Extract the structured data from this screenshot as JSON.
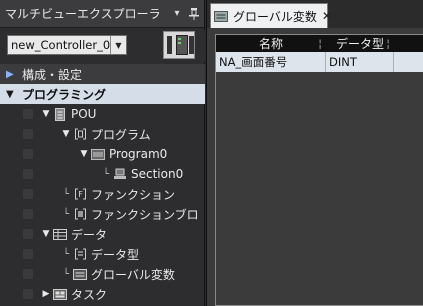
{
  "left_panel": {
    "title": "マルチビューエクスプローラ",
    "controller": {
      "value": "new_Controller_0"
    },
    "sections": {
      "config": "構成・設定",
      "programming": "プログラミング"
    },
    "tree": {
      "pou": "POU",
      "program": "プログラム",
      "program0": "Program0",
      "section0": "Section0",
      "function": "ファンクション",
      "function_block": "ファンクションブロ",
      "data": "データ",
      "data_type": "データ型",
      "global_vars": "グローバル変数",
      "task": "タスク"
    }
  },
  "right_panel": {
    "tab": {
      "label": "グローバル変数"
    },
    "grid": {
      "columns": [
        "名称",
        "データ型"
      ],
      "rows": [
        [
          "NA_画面番号",
          "DINT"
        ]
      ]
    }
  }
}
